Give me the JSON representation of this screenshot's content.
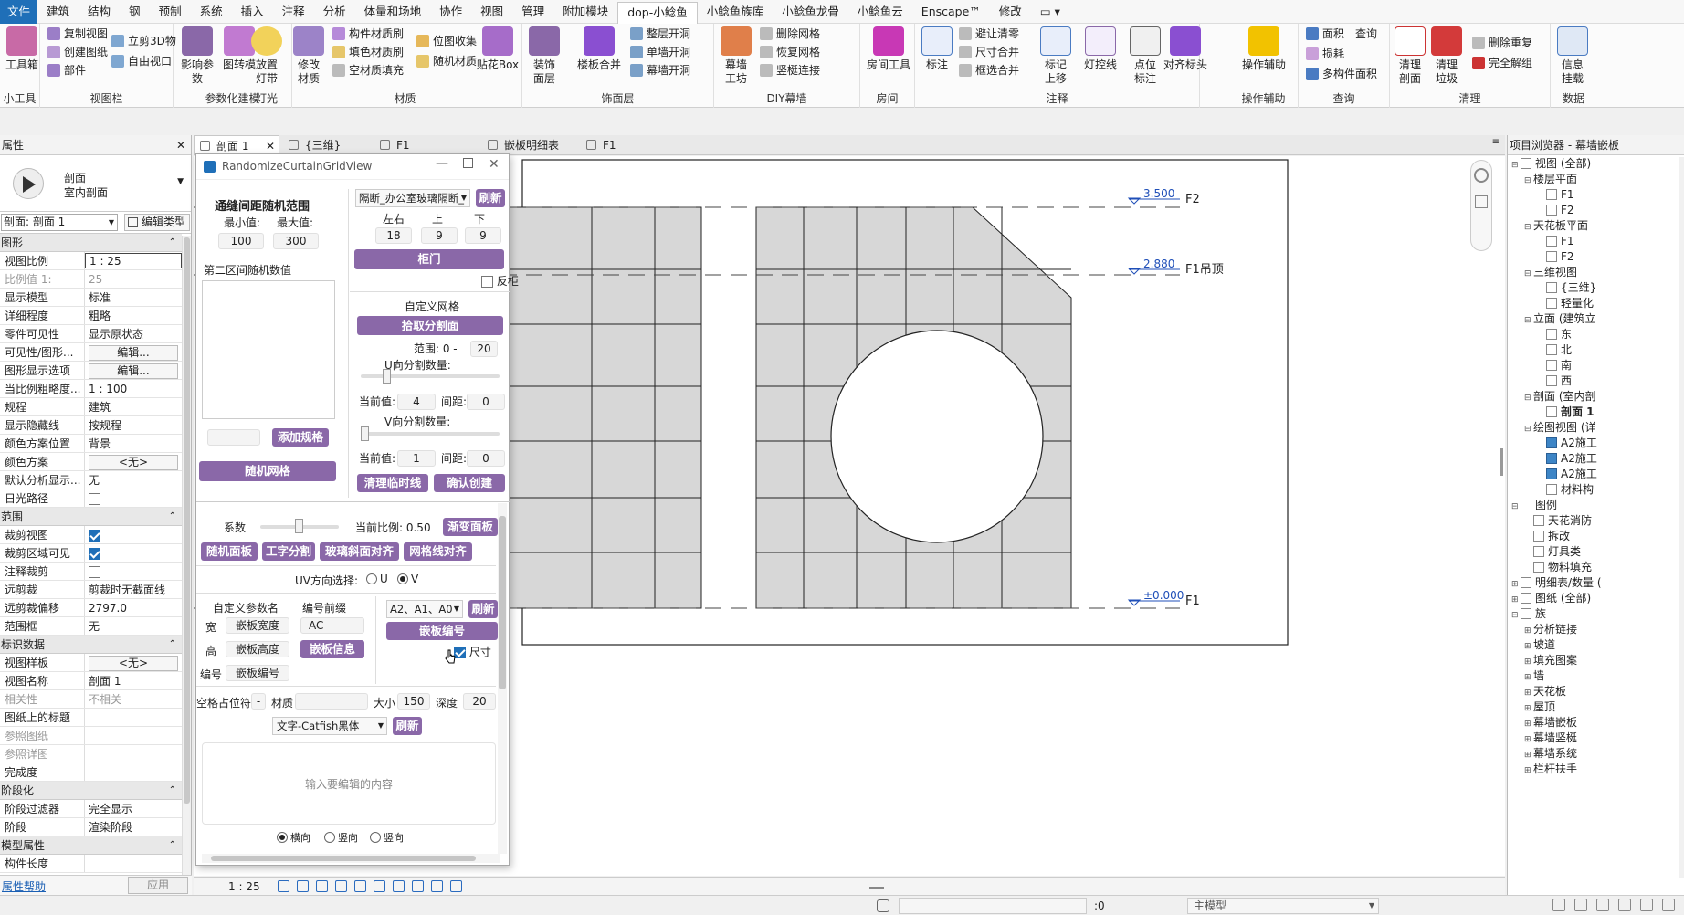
{
  "menubar": {
    "items": [
      "文件",
      "建筑",
      "结构",
      "钢",
      "预制",
      "系统",
      "插入",
      "注释",
      "分析",
      "体量和场地",
      "协作",
      "视图",
      "管理",
      "附加模块",
      "dop-小鲶鱼",
      "小鲶鱼族库",
      "小鲶鱼龙骨",
      "小鲶鱼云",
      "Enscape™",
      "修改"
    ]
  },
  "ribbon": {
    "groups": [
      "小工具",
      "视图栏",
      "参数化建模",
      "灯光",
      "材质",
      "饰面层",
      "DIY幕墙",
      "房间",
      "注释",
      "操作辅助",
      "查询",
      "清理",
      "数据"
    ],
    "toolbox": "工具箱",
    "copy_view": "复制视图",
    "create_sheet": "创建图纸",
    "part": "部件",
    "cube3d": "立剪3D物",
    "free_view": "自由视口",
    "shadow_param": "影响参数",
    "paste_brick": "图转模",
    "place_light": "放置\n灯带",
    "modify_material": "修改\n材质",
    "member_material": "构件材质刷",
    "fill_material": "填色材质刷",
    "void_fill": "空材质填充",
    "position_collect": "位图收集",
    "random_material": "随机材质",
    "paste_box": "贴花Box",
    "decor_layer": "装饰\n面层",
    "floor_merge": "楼板合并",
    "whole_layer_open": "整层开洞",
    "single_open": "单墙开洞",
    "curtain_open": "幕墙开洞",
    "curtain_grid": "幕墙\n工坊",
    "delete_grid": "删除网格",
    "restore_grid": "恢复网格",
    "mullion_connect": "竖梃连接",
    "room_tool": "房间工具",
    "dim_label": "标注",
    "avoid_clear": "避让清零",
    "dim_merge": "尺寸合并",
    "frame_merge": "框选合并",
    "mark_up": "标记\n上移",
    "light_ctrl": "灯控线",
    "point_mark": "点位\n标注",
    "align_head": "对齐标头",
    "op_assist": "操作辅助",
    "area": "面积",
    "query": "查询",
    "loss": "损耗",
    "multi_area": "多构件面积",
    "clean_section": "清理\n剖面",
    "clean_trash": "清理\n垃圾",
    "delete_dup": "删除重复",
    "full_ungroup": "完全解组",
    "info_mount": "信息\n挂载"
  },
  "properties": {
    "title": "属性",
    "type_name": "剖面",
    "type_sub": "室内剖面",
    "selector": "剖面: 剖面 1",
    "edit_type": "编辑类型",
    "sections": {
      "graphics": "图形",
      "extents": "范围",
      "identity": "标识数据",
      "phasing": "阶段化",
      "model": "模型属性"
    },
    "graphics_rows": [
      {
        "k": "视图比例",
        "v": "1 : 25",
        "boxed": true
      },
      {
        "k": "比例值 1:",
        "v": "25",
        "dim": true
      },
      {
        "k": "显示模型",
        "v": "标准"
      },
      {
        "k": "详细程度",
        "v": "粗略"
      },
      {
        "k": "零件可见性",
        "v": "显示原状态"
      },
      {
        "k": "可见性/图形...",
        "v": "编辑...",
        "btn": true
      },
      {
        "k": "图形显示选项",
        "v": "编辑...",
        "btn": true
      },
      {
        "k": "当比例粗略度...",
        "v": "1 : 100"
      },
      {
        "k": "规程",
        "v": "建筑"
      },
      {
        "k": "显示隐藏线",
        "v": "按规程"
      },
      {
        "k": "颜色方案位置",
        "v": "背景"
      },
      {
        "k": "颜色方案",
        "v": "<无>",
        "btn": true
      },
      {
        "k": "默认分析显示...",
        "v": "无"
      },
      {
        "k": "日光路径",
        "v": "",
        "check": false
      }
    ],
    "extents_rows": [
      {
        "k": "裁剪视图",
        "v": "",
        "check": true
      },
      {
        "k": "裁剪区域可见",
        "v": "",
        "check": true
      },
      {
        "k": "注释裁剪",
        "v": "",
        "check": false
      },
      {
        "k": "远剪裁",
        "v": "剪裁时无截面线"
      },
      {
        "k": "远剪裁偏移",
        "v": "2797.0"
      },
      {
        "k": "范围框",
        "v": "无"
      }
    ],
    "identity_rows": [
      {
        "k": "视图样板",
        "v": "<无>",
        "btn": true
      },
      {
        "k": "视图名称",
        "v": "剖面 1"
      },
      {
        "k": "相关性",
        "v": "不相关",
        "dim": true
      },
      {
        "k": "图纸上的标题",
        "v": ""
      },
      {
        "k": "参照图纸",
        "v": "",
        "dim": true
      },
      {
        "k": "参照详图",
        "v": "",
        "dim": true
      },
      {
        "k": "完成度",
        "v": ""
      }
    ],
    "phasing_rows": [
      {
        "k": "阶段过滤器",
        "v": "完全显示"
      },
      {
        "k": "阶段",
        "v": "渲染阶段"
      }
    ],
    "model_rows": [
      {
        "k": "构件长度",
        "v": ""
      }
    ],
    "help": "属性帮助",
    "apply": "应用"
  },
  "tabs": [
    {
      "label": "剖面 1",
      "active": true,
      "close": "✕"
    },
    {
      "label": "{三维}",
      "active": false,
      "close": ""
    },
    {
      "label": "F1",
      "active": false,
      "close": ""
    },
    {
      "label": "嵌板明细表",
      "active": false,
      "close": ""
    },
    {
      "label": "F1",
      "active": false,
      "close": ""
    }
  ],
  "levels": [
    {
      "value": "3.500",
      "name": "F2"
    },
    {
      "value": "2.880",
      "name": "F1吊顶"
    },
    {
      "value": "±0.000",
      "name": "F1"
    }
  ],
  "viewctrl": {
    "scale": "1 : 25"
  },
  "browser": {
    "title": "项目浏览器 - 幕墙嵌板",
    "items": [
      {
        "t": "视图 (全部)",
        "lvl": 0,
        "exp": "⊟",
        "icon": "view"
      },
      {
        "t": "楼层平面",
        "lvl": 1,
        "exp": "⊟"
      },
      {
        "t": "F1",
        "lvl": 2,
        "icon": "plain"
      },
      {
        "t": "F2",
        "lvl": 2,
        "icon": "plain"
      },
      {
        "t": "天花板平面",
        "lvl": 1,
        "exp": "⊟"
      },
      {
        "t": "F1",
        "lvl": 2,
        "icon": "plain"
      },
      {
        "t": "F2",
        "lvl": 2,
        "icon": "plain"
      },
      {
        "t": "三维视图",
        "lvl": 1,
        "exp": "⊟"
      },
      {
        "t": "{三维}",
        "lvl": 2,
        "icon": "plain"
      },
      {
        "t": "轻量化",
        "lvl": 2,
        "icon": "plain"
      },
      {
        "t": "立面 (建筑立",
        "lvl": 1,
        "exp": "⊟"
      },
      {
        "t": "东",
        "lvl": 2,
        "icon": "plain"
      },
      {
        "t": "北",
        "lvl": 2,
        "icon": "plain"
      },
      {
        "t": "南",
        "lvl": 2,
        "icon": "plain"
      },
      {
        "t": "西",
        "lvl": 2,
        "icon": "plain"
      },
      {
        "t": "剖面 (室内剖",
        "lvl": 1,
        "exp": "⊟"
      },
      {
        "t": "剖面 1",
        "lvl": 2,
        "icon": "plain",
        "bold": true
      },
      {
        "t": "绘图视图 (详",
        "lvl": 1,
        "exp": "⊟"
      },
      {
        "t": "A2施工",
        "lvl": 2,
        "icon": "blue"
      },
      {
        "t": "A2施工",
        "lvl": 2,
        "icon": "blue"
      },
      {
        "t": "A2施工",
        "lvl": 2,
        "icon": "blue"
      },
      {
        "t": "材料构",
        "lvl": 2,
        "icon": "plain"
      },
      {
        "t": "图例",
        "lvl": 0,
        "exp": "⊟",
        "icon": "plain"
      },
      {
        "t": "天花消防",
        "lvl": 1,
        "icon": "plain"
      },
      {
        "t": "拆改",
        "lvl": 1,
        "icon": "plain"
      },
      {
        "t": "灯具类",
        "lvl": 1,
        "icon": "plain"
      },
      {
        "t": "物料填充",
        "lvl": 1,
        "icon": "plain"
      },
      {
        "t": "明细表/数量 (",
        "lvl": 0,
        "exp": "⊞",
        "icon": "plain"
      },
      {
        "t": "图纸 (全部)",
        "lvl": 0,
        "exp": "⊞",
        "icon": "plain"
      },
      {
        "t": "族",
        "lvl": 0,
        "exp": "⊟",
        "icon": "plain"
      },
      {
        "t": "分析链接",
        "lvl": 1,
        "exp": "⊞"
      },
      {
        "t": "坡道",
        "lvl": 1,
        "exp": "⊞"
      },
      {
        "t": "填充图案",
        "lvl": 1,
        "exp": "⊞"
      },
      {
        "t": "墙",
        "lvl": 1,
        "exp": "⊞"
      },
      {
        "t": "天花板",
        "lvl": 1,
        "exp": "⊞"
      },
      {
        "t": "屋顶",
        "lvl": 1,
        "exp": "⊞"
      },
      {
        "t": "幕墙嵌板",
        "lvl": 1,
        "exp": "⊞"
      },
      {
        "t": "幕墙竖梃",
        "lvl": 1,
        "exp": "⊞"
      },
      {
        "t": "幕墙系统",
        "lvl": 1,
        "exp": "⊞"
      },
      {
        "t": "栏杆扶手",
        "lvl": 1,
        "exp": "⊞"
      }
    ]
  },
  "dialog": {
    "title": "RandomizeCurtainGridView",
    "left": {
      "heading": "通缝间距随机范围",
      "min_label": "最小值:",
      "max_label": "最大值:",
      "min_val": "100",
      "max_val": "300",
      "second_label": "第二区间随机数值",
      "add_spec": "添加规格",
      "random_grid": "随机网格"
    },
    "right": {
      "dropdown": "隔断_办公室玻璃隔断_",
      "refresh": "刷新",
      "lr": "左右",
      "up": "上",
      "down": "下",
      "lr_val": "18",
      "up_val": "9",
      "down_val": "9",
      "cabinet": "柜门",
      "reverse": "反柜",
      "custom_grid": "自定义网格",
      "pick_face": "拾取分割面",
      "range_label": "范围: 0 -",
      "range_val": "20",
      "u_label": "U向分割数量:",
      "u_cur": "当前值:",
      "u_cur_val": "4",
      "u_gap": "间距:",
      "u_gap_val": "0",
      "v_label": "V向分割数量:",
      "v_cur": "当前值:",
      "v_cur_val": "1",
      "v_gap": "间距:",
      "v_gap_val": "0",
      "clear_temp": "清理临时线",
      "confirm_create": "确认创建"
    },
    "lower": {
      "coef": "系数",
      "ratio": "当前比例: 0.50",
      "gradient_panel": "渐变面板",
      "btn_random_panel": "随机面板",
      "btn_i_split": "工字分割",
      "btn_glass_align": "玻璃斜面对齐",
      "btn_gridline_align": "网格线对齐",
      "uv_label": "UV方向选择:",
      "u": "U",
      "v": "V",
      "custom_param": "自定义参数名",
      "code_prefix": "编号前缀",
      "w": "宽",
      "w_val": "嵌板宽度",
      "prefix_val": "AC",
      "h": "高",
      "h_val": "嵌板高度",
      "panel_info": "嵌板信息",
      "num": "编号",
      "num_val": "嵌板编号",
      "select_val": "A2、A1、A0",
      "refresh2": "刷新",
      "panel_number": "嵌板编号",
      "dimension": "尺寸",
      "placeholder_label": "空格占位符",
      "dash": "-",
      "material": "材质",
      "size": "大小",
      "size_val": "150",
      "depth": "深度",
      "depth_val": "20",
      "font_select": "文字-Catfish黑体",
      "refresh3": "刷新",
      "text_placeholder": "输入要编辑的内容",
      "radio_h": "横向",
      "radio_v": "竖向",
      "radio_o": "竖向"
    }
  },
  "status": {
    "model": "主模型",
    "zero": ":0"
  },
  "colors": {
    "accent": "#8a68a8",
    "file_tab": "#1f6fb8",
    "panel_fill": "#d7d7d7"
  }
}
